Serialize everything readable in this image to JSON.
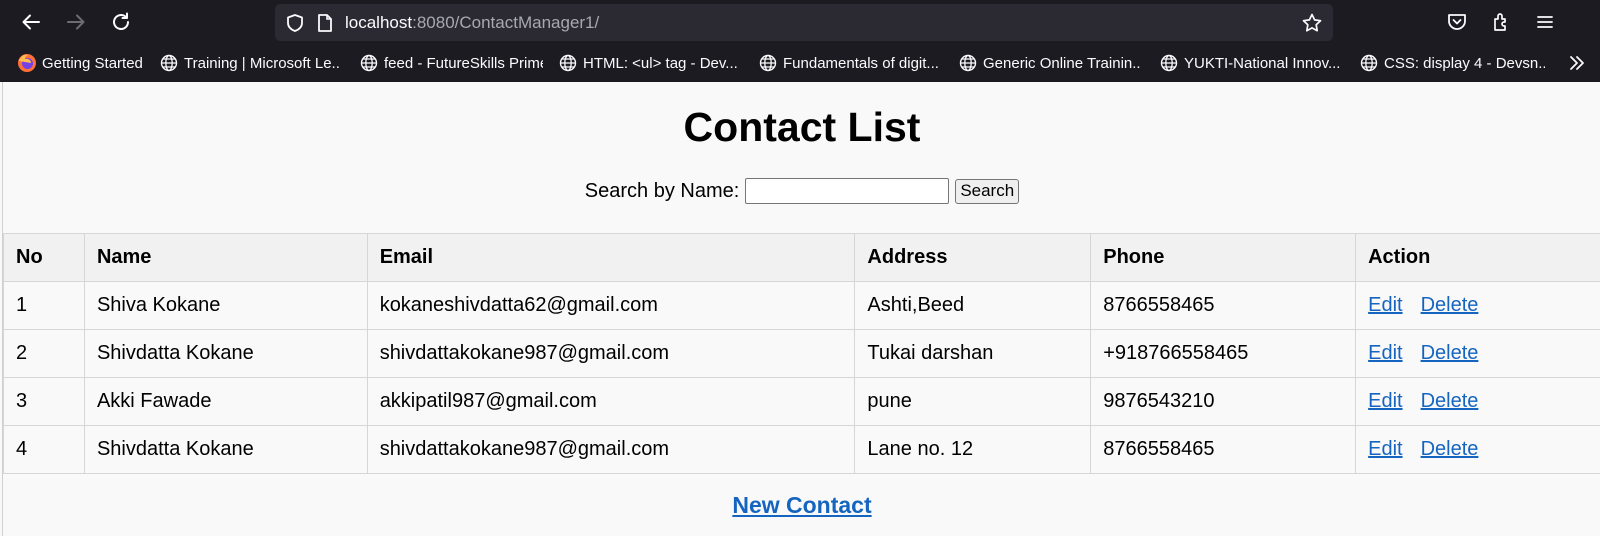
{
  "browser": {
    "url_host": "localhost",
    "url_rest": ":8080/ContactManager1/",
    "bookmarks": [
      {
        "label": "Getting Started",
        "icon": "firefox-icon"
      },
      {
        "label": "Training | Microsoft Le...",
        "icon": "globe-icon"
      },
      {
        "label": "feed - FutureSkills Prime",
        "icon": "globe-icon"
      },
      {
        "label": "HTML: <ul> tag - Dev...",
        "icon": "globe-icon"
      },
      {
        "label": "Fundamentals of digit...",
        "icon": "globe-icon"
      },
      {
        "label": "Generic Online Trainin...",
        "icon": "globe-icon"
      },
      {
        "label": "YUKTI-National Innov...",
        "icon": "globe-icon"
      },
      {
        "label": "CSS: display 4 - Devsn...",
        "icon": "globe-icon"
      }
    ]
  },
  "page": {
    "title": "Contact List",
    "search": {
      "label": "Search by Name:",
      "value": "",
      "placeholder": "",
      "button_label": "Search"
    },
    "table": {
      "headers": [
        "No",
        "Name",
        "Email",
        "Address",
        "Phone",
        "Action"
      ],
      "rows": [
        {
          "no": "1",
          "name": "Shiva Kokane",
          "email": "kokaneshivdatta62@gmail.com",
          "address": "Ashti,Beed",
          "phone": "8766558465",
          "edit": "Edit",
          "delete": "Delete"
        },
        {
          "no": "2",
          "name": "Shivdatta Kokane",
          "email": "shivdattakokane987@gmail.com",
          "address": "Tukai darshan",
          "phone": "+918766558465",
          "edit": "Edit",
          "delete": "Delete"
        },
        {
          "no": "3",
          "name": "Akki Fawade",
          "email": "akkipatil987@gmail.com",
          "address": "pune",
          "phone": "9876543210",
          "edit": "Edit",
          "delete": "Delete"
        },
        {
          "no": "4",
          "name": "Shivdatta Kokane",
          "email": "shivdattakokane987@gmail.com",
          "address": "Lane no. 12",
          "phone": "8766558465",
          "edit": "Edit",
          "delete": "Delete"
        }
      ]
    },
    "new_contact_label": "New Contact"
  },
  "colors": {
    "chrome_bg": "#1c1b22",
    "urlbar_bg": "#2b2a33",
    "link": "#1565c0",
    "page_bg": "#f9f9f9"
  }
}
